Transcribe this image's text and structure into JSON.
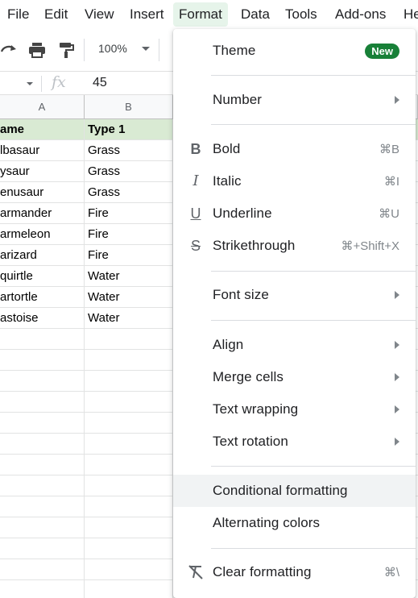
{
  "menubar": {
    "items": [
      "File",
      "Edit",
      "View",
      "Insert",
      "Format",
      "Data",
      "Tools",
      "Add-ons",
      "He"
    ]
  },
  "toolbar": {
    "zoom": "100%",
    "icons": [
      "redo-icon",
      "print-icon",
      "paint-format-icon"
    ]
  },
  "formula_bar": {
    "fx": "fx",
    "value": "45"
  },
  "grid": {
    "columns": [
      "A",
      "B"
    ],
    "header": [
      "ame",
      "Type 1"
    ],
    "rows": [
      [
        "lbasaur",
        "Grass"
      ],
      [
        "ysaur",
        "Grass"
      ],
      [
        "enusaur",
        "Grass"
      ],
      [
        "armander",
        "Fire"
      ],
      [
        "armeleon",
        "Fire"
      ],
      [
        "arizard",
        "Fire"
      ],
      [
        "quirtle",
        "Water"
      ],
      [
        "artortle",
        "Water"
      ],
      [
        "astoise",
        "Water"
      ]
    ],
    "header_fill": "#d9ead3"
  },
  "format_menu": {
    "theme": {
      "label": "Theme",
      "badge": "New"
    },
    "number": {
      "label": "Number"
    },
    "bold": {
      "label": "Bold",
      "shortcut": "⌘B",
      "icon": "B"
    },
    "italic": {
      "label": "Italic",
      "shortcut": "⌘I",
      "icon": "I"
    },
    "underline": {
      "label": "Underline",
      "shortcut": "⌘U",
      "icon": "U"
    },
    "strikethrough": {
      "label": "Strikethrough",
      "shortcut": "⌘+Shift+X",
      "icon": "S"
    },
    "font_size": {
      "label": "Font size"
    },
    "align": {
      "label": "Align"
    },
    "merge_cells": {
      "label": "Merge cells"
    },
    "text_wrapping": {
      "label": "Text wrapping"
    },
    "text_rotation": {
      "label": "Text rotation"
    },
    "conditional_formatting": {
      "label": "Conditional formatting"
    },
    "alternating_colors": {
      "label": "Alternating colors"
    },
    "clear_formatting": {
      "label": "Clear formatting",
      "shortcut": "⌘\\"
    }
  },
  "colors": {
    "active_menu": "#e6f4ea",
    "badge": "#188038",
    "hover": "#f1f3f4"
  }
}
